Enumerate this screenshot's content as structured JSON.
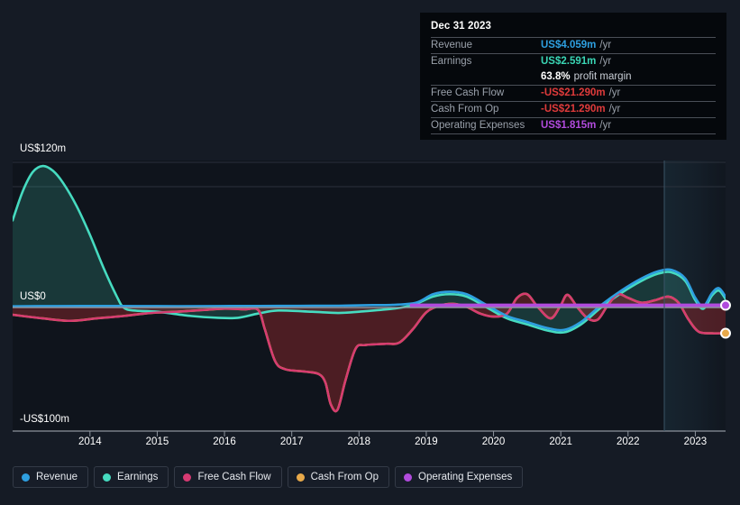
{
  "chart_data": {
    "type": "area",
    "title": "",
    "xlabel": "",
    "ylabel": "",
    "grid": true,
    "legend_position": "bottom",
    "ylim": [
      -100,
      120
    ],
    "ytick_labels": [
      "US$120m",
      "US$0",
      "-US$100m"
    ],
    "ytick_values": [
      120,
      0,
      -100
    ],
    "xtick_labels": [
      "2014",
      "2015",
      "2016",
      "2017",
      "2018",
      "2019",
      "2020",
      "2021",
      "2022",
      "2023"
    ],
    "x_start": 2013.35,
    "x_end": 2023.95,
    "forecast_divider_x": 2022.2,
    "series": [
      {
        "name": "Revenue",
        "color": "#2e9fe0",
        "fill": "none",
        "points": [
          [
            2013.35,
            1.0
          ],
          [
            2014.0,
            1.2
          ],
          [
            2014.6,
            1.3
          ],
          [
            2015.2,
            1.2
          ],
          [
            2015.8,
            1.1
          ],
          [
            2016.4,
            1.2
          ],
          [
            2017.0,
            1.3
          ],
          [
            2017.6,
            1.4
          ],
          [
            2018.2,
            1.5
          ],
          [
            2018.7,
            2.0
          ],
          [
            2019.0,
            2.2
          ],
          [
            2019.35,
            4.0
          ],
          [
            2019.6,
            11.0
          ],
          [
            2019.85,
            13.0
          ],
          [
            2020.1,
            11.0
          ],
          [
            2020.4,
            2.0
          ],
          [
            2020.7,
            -7.0
          ],
          [
            2021.0,
            -12.0
          ],
          [
            2021.3,
            -17.0
          ],
          [
            2021.55,
            -18.5
          ],
          [
            2021.8,
            -12.0
          ],
          [
            2022.1,
            2.0
          ],
          [
            2022.4,
            14.0
          ],
          [
            2022.7,
            24.0
          ],
          [
            2022.95,
            30.0
          ],
          [
            2023.15,
            31.0
          ],
          [
            2023.35,
            24.0
          ],
          [
            2023.5,
            8.0
          ],
          [
            2023.62,
            1.0
          ],
          [
            2023.75,
            12.0
          ],
          [
            2023.85,
            16.0
          ],
          [
            2023.95,
            9.0
          ]
        ]
      },
      {
        "name": "Earnings",
        "color": "#46dbc0",
        "fill": "rgba(70,219,192,0.18)",
        "points": [
          [
            2013.35,
            72.0
          ],
          [
            2013.5,
            96.0
          ],
          [
            2013.65,
            112.0
          ],
          [
            2013.8,
            117.0
          ],
          [
            2013.95,
            113.0
          ],
          [
            2014.1,
            103.0
          ],
          [
            2014.3,
            84.0
          ],
          [
            2014.5,
            60.0
          ],
          [
            2014.7,
            33.0
          ],
          [
            2014.9,
            9.0
          ],
          [
            2015.0,
            0.0
          ],
          [
            2015.15,
            -2.5
          ],
          [
            2015.5,
            -3.5
          ],
          [
            2016.0,
            -7.0
          ],
          [
            2016.4,
            -8.5
          ],
          [
            2016.7,
            -8.5
          ],
          [
            2017.0,
            -5.0
          ],
          [
            2017.3,
            -2.5
          ],
          [
            2017.8,
            -3.5
          ],
          [
            2018.2,
            -4.5
          ],
          [
            2018.6,
            -3.0
          ],
          [
            2019.0,
            -1.0
          ],
          [
            2019.3,
            2.0
          ],
          [
            2019.6,
            9.0
          ],
          [
            2019.85,
            11.0
          ],
          [
            2020.1,
            9.0
          ],
          [
            2020.4,
            0.0
          ],
          [
            2020.7,
            -9.0
          ],
          [
            2021.0,
            -14.0
          ],
          [
            2021.3,
            -19.0
          ],
          [
            2021.55,
            -20.5
          ],
          [
            2021.8,
            -14.0
          ],
          [
            2022.1,
            0.0
          ],
          [
            2022.4,
            12.0
          ],
          [
            2022.7,
            22.0
          ],
          [
            2022.95,
            28.0
          ],
          [
            2023.15,
            29.0
          ],
          [
            2023.35,
            22.0
          ],
          [
            2023.5,
            6.0
          ],
          [
            2023.62,
            -1.0
          ],
          [
            2023.75,
            10.0
          ],
          [
            2023.85,
            14.0
          ],
          [
            2023.95,
            7.0
          ]
        ]
      },
      {
        "name": "Free Cash Flow",
        "color": "#d63a72",
        "fill": "none",
        "points": [
          [
            2013.35,
            -6.0
          ],
          [
            2013.8,
            -9.0
          ],
          [
            2014.2,
            -11.0
          ],
          [
            2014.6,
            -9.0
          ],
          [
            2015.0,
            -7.0
          ],
          [
            2015.4,
            -4.5
          ],
          [
            2015.8,
            -3.5
          ],
          [
            2016.2,
            -2.0
          ],
          [
            2016.5,
            -1.0
          ],
          [
            2016.8,
            -1.5
          ],
          [
            2017.0,
            -2.0
          ],
          [
            2017.1,
            -18.0
          ],
          [
            2017.25,
            -44.0
          ],
          [
            2017.4,
            -51.0
          ],
          [
            2017.7,
            -53.0
          ],
          [
            2017.9,
            -55.0
          ],
          [
            2018.0,
            -62.0
          ],
          [
            2018.08,
            -80.0
          ],
          [
            2018.18,
            -84.5
          ],
          [
            2018.3,
            -60.0
          ],
          [
            2018.45,
            -34.0
          ],
          [
            2018.6,
            -31.0
          ],
          [
            2018.9,
            -30.0
          ],
          [
            2019.1,
            -29.0
          ],
          [
            2019.3,
            -18.0
          ],
          [
            2019.5,
            -4.0
          ],
          [
            2019.7,
            1.5
          ],
          [
            2019.9,
            3.0
          ],
          [
            2020.1,
            0.5
          ],
          [
            2020.3,
            -5.0
          ],
          [
            2020.5,
            -7.5
          ],
          [
            2020.7,
            -5.0
          ],
          [
            2020.85,
            8.0
          ],
          [
            2021.0,
            11.0
          ],
          [
            2021.15,
            1.0
          ],
          [
            2021.35,
            -9.0
          ],
          [
            2021.5,
            2.0
          ],
          [
            2021.6,
            10.5
          ],
          [
            2021.75,
            0.0
          ],
          [
            2021.9,
            -9.0
          ],
          [
            2022.05,
            -10.0
          ],
          [
            2022.2,
            2.0
          ],
          [
            2022.35,
            11.0
          ],
          [
            2022.5,
            8.0
          ],
          [
            2022.7,
            4.0
          ],
          [
            2022.9,
            6.0
          ],
          [
            2023.1,
            9.0
          ],
          [
            2023.25,
            4.0
          ],
          [
            2023.4,
            -10.0
          ],
          [
            2023.55,
            -20.0
          ],
          [
            2023.75,
            -21.29
          ],
          [
            2023.9,
            -21.29
          ],
          [
            2023.95,
            -21.29
          ]
        ]
      },
      {
        "name": "Cash From Op",
        "color": "#e8a94a",
        "fill": "rgba(150,40,45,0.45)",
        "points": [
          [
            2013.35,
            -6.0
          ],
          [
            2013.8,
            -9.0
          ],
          [
            2014.2,
            -11.0
          ],
          [
            2014.6,
            -9.0
          ],
          [
            2015.0,
            -7.0
          ],
          [
            2015.4,
            -4.5
          ],
          [
            2015.8,
            -3.5
          ],
          [
            2016.2,
            -2.0
          ],
          [
            2016.5,
            -1.0
          ],
          [
            2016.8,
            -1.5
          ],
          [
            2017.0,
            -2.0
          ],
          [
            2017.1,
            -18.0
          ],
          [
            2017.25,
            -44.0
          ],
          [
            2017.4,
            -51.0
          ],
          [
            2017.7,
            -53.0
          ],
          [
            2017.9,
            -55.0
          ],
          [
            2018.0,
            -62.0
          ],
          [
            2018.08,
            -80.0
          ],
          [
            2018.18,
            -84.5
          ],
          [
            2018.3,
            -60.0
          ],
          [
            2018.45,
            -34.0
          ],
          [
            2018.6,
            -31.0
          ],
          [
            2018.9,
            -30.0
          ],
          [
            2019.1,
            -29.0
          ],
          [
            2019.3,
            -18.0
          ],
          [
            2019.5,
            -4.0
          ],
          [
            2019.7,
            1.5
          ],
          [
            2019.9,
            3.0
          ],
          [
            2020.1,
            0.5
          ],
          [
            2020.3,
            -5.0
          ],
          [
            2020.5,
            -7.5
          ],
          [
            2020.7,
            -5.0
          ],
          [
            2020.85,
            8.0
          ],
          [
            2021.0,
            11.0
          ],
          [
            2021.15,
            1.0
          ],
          [
            2021.35,
            -9.0
          ],
          [
            2021.5,
            2.0
          ],
          [
            2021.6,
            10.5
          ],
          [
            2021.75,
            0.0
          ],
          [
            2021.9,
            -9.0
          ],
          [
            2022.05,
            -10.0
          ],
          [
            2022.2,
            2.0
          ],
          [
            2022.35,
            11.0
          ],
          [
            2022.5,
            8.0
          ],
          [
            2022.7,
            4.0
          ],
          [
            2022.9,
            6.0
          ],
          [
            2023.1,
            9.0
          ],
          [
            2023.25,
            4.0
          ],
          [
            2023.4,
            -10.0
          ],
          [
            2023.55,
            -20.0
          ],
          [
            2023.75,
            -21.29
          ],
          [
            2023.9,
            -21.29
          ],
          [
            2023.95,
            -21.29
          ]
        ]
      },
      {
        "name": "Operating Expenses",
        "color": "#b14bdd",
        "fill": "none",
        "points": [
          [
            2019.28,
            1.8
          ],
          [
            2020.0,
            1.8
          ],
          [
            2021.0,
            1.8
          ],
          [
            2022.0,
            1.8
          ],
          [
            2023.0,
            1.8
          ],
          [
            2023.95,
            1.815
          ]
        ]
      }
    ],
    "endpoint_markers": [
      {
        "name": "operating-expenses-endpoint",
        "x": 2023.95,
        "y": 1.815,
        "color": "#b14bdd"
      },
      {
        "name": "cash-from-op-endpoint",
        "x": 2023.95,
        "y": -21.29,
        "color": "#e8a94a"
      }
    ]
  },
  "tooltip": {
    "date": "Dec 31 2023",
    "rows": [
      {
        "label": "Revenue",
        "value": "US$4.059m",
        "unit": "/yr",
        "color": "#2e9fe0"
      },
      {
        "label": "Earnings",
        "value": "US$2.591m",
        "unit": "/yr",
        "color": "#3ad6b5"
      }
    ],
    "profit_margin": {
      "value": "63.8%",
      "note": "profit margin",
      "color": "#ffffff"
    },
    "rows2": [
      {
        "label": "Free Cash Flow",
        "value": "-US$21.290m",
        "unit": "/yr",
        "color": "#e03b3b"
      },
      {
        "label": "Cash From Op",
        "value": "-US$21.290m",
        "unit": "/yr",
        "color": "#e03b3b"
      },
      {
        "label": "Operating Expenses",
        "value": "US$1.815m",
        "unit": "/yr",
        "color": "#b14bdd"
      }
    ]
  },
  "legend": {
    "items": [
      {
        "label": "Revenue",
        "color": "#2e9fe0"
      },
      {
        "label": "Earnings",
        "color": "#46dbc0"
      },
      {
        "label": "Free Cash Flow",
        "color": "#d63a72"
      },
      {
        "label": "Cash From Op",
        "color": "#e8a94a"
      },
      {
        "label": "Operating Expenses",
        "color": "#b14bdd"
      }
    ]
  }
}
